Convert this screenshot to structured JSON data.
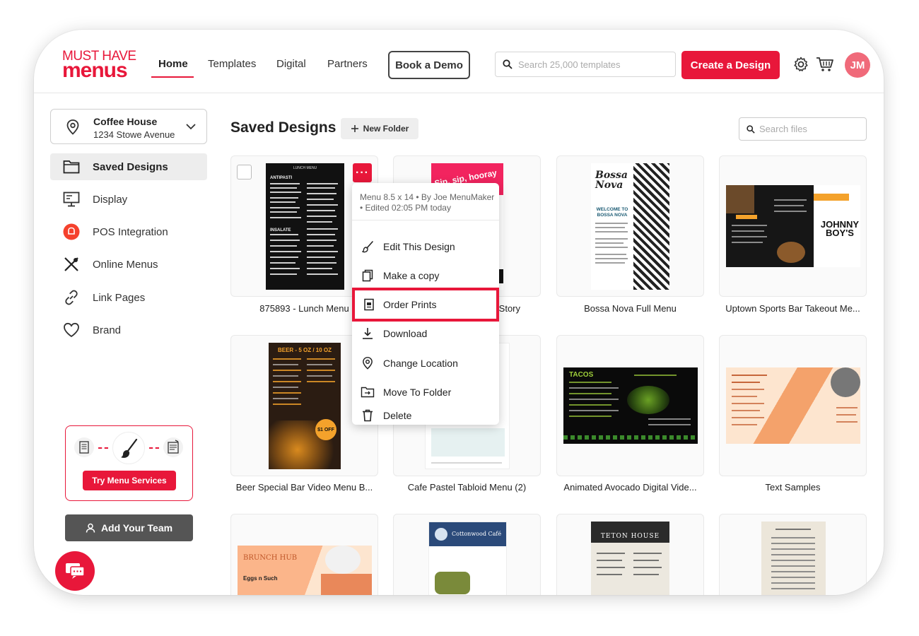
{
  "brand": {
    "line1": "MUST HAVE",
    "line2": "menus"
  },
  "nav": [
    {
      "label": "Home"
    },
    {
      "label": "Templates"
    },
    {
      "label": "Digital"
    },
    {
      "label": "Partners"
    }
  ],
  "header": {
    "demo_label": "Book a Demo",
    "search_placeholder": "Search 25,000 templates",
    "create_label": "Create a Design",
    "avatar_initials": "JM"
  },
  "location": {
    "name": "Coffee House",
    "address": "1234 Stowe Avenue"
  },
  "sidebar": {
    "items": [
      {
        "label": "Saved Designs",
        "icon": "folder-icon"
      },
      {
        "label": "Display",
        "icon": "display-icon"
      },
      {
        "label": "POS Integration",
        "icon": "pos-icon"
      },
      {
        "label": "Online Menus",
        "icon": "utensils-icon"
      },
      {
        "label": "Link Pages",
        "icon": "link-icon"
      },
      {
        "label": "Brand",
        "icon": "heart-icon"
      }
    ],
    "promo_label": "Try Menu Services",
    "team_label": "Add Your Team"
  },
  "main": {
    "title": "Saved Designs",
    "new_folder_label": "New Folder",
    "search_placeholder": "Search files",
    "cards": [
      {
        "label": "875893 - Lunch Menu"
      },
      {
        "label": "Story"
      },
      {
        "label": "Bossa Nova Full Menu"
      },
      {
        "label": "Uptown Sports Bar Takeout Me..."
      },
      {
        "label": "Beer Special Bar Video Menu B..."
      },
      {
        "label": "Cafe Pastel Tabloid Menu (2)"
      },
      {
        "label": "Animated Avocado Digital Vide..."
      },
      {
        "label": "Text Samples"
      }
    ],
    "thumb_text": {
      "lunch_title": "LUNCH MENU",
      "lunch_col1": "ANTIPASTI",
      "lunch_col2": "INSALATE",
      "sip_text": "Sip, sip, hooray",
      "bossa_title": "Bossa Nova",
      "bossa_welcome": "WELCOME TO BOSSA NOVA",
      "johnny_line1": "JOHNNY",
      "johnny_line2": "BOY'S",
      "beer_title": "BEER - 5 OZ / 10 OZ",
      "beer_offer": "$1 OFF",
      "tacos_title": "TACOS",
      "brunch_title": "BRUNCH HUB",
      "brunch_item": "Eggs n Such",
      "cottonwood_title": "Cottonwood Café",
      "teton_title": "TETON HOUSE"
    }
  },
  "context_menu": {
    "meta_line1": "Menu 8.5 x 14 • By Joe MenuMaker",
    "meta_line2": "• Edited 02:05 PM today",
    "items": [
      {
        "label": "Edit This Design",
        "icon": "brush-icon"
      },
      {
        "label": "Make a copy",
        "icon": "copy-icon"
      },
      {
        "label": "Order Prints",
        "icon": "print-icon"
      },
      {
        "label": "Download",
        "icon": "download-icon"
      },
      {
        "label": "Change Location",
        "icon": "location-pin-icon"
      },
      {
        "label": "Move To Folder",
        "icon": "move-folder-icon"
      },
      {
        "label": "Delete",
        "icon": "trash-icon"
      }
    ],
    "highlighted_item": "Order Prints"
  },
  "colors": {
    "accent": "#e8173a",
    "sidebar_active": "#ededed",
    "team_button": "#555555"
  }
}
